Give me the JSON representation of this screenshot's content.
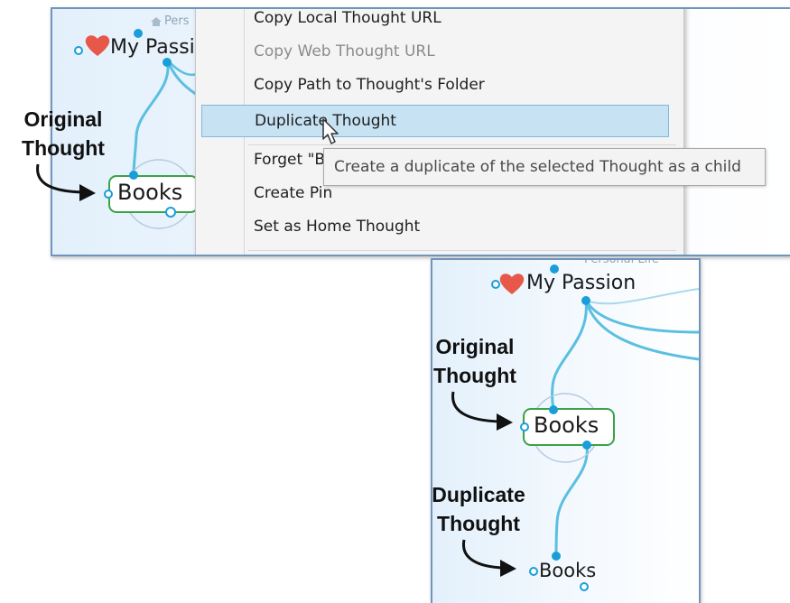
{
  "context_menu": {
    "items": [
      {
        "label": "Copy Local Thought URL",
        "disabled": false
      },
      {
        "label": "Copy Web Thought URL",
        "disabled": true
      },
      {
        "label": "Copy Path to Thought's Folder",
        "disabled": false
      },
      {
        "label": "Duplicate Thought",
        "disabled": false,
        "highlighted": true
      },
      {
        "label": "Forget \"Books\"",
        "disabled": false
      },
      {
        "label": "Create Pin",
        "disabled": false
      },
      {
        "label": "Set as Home Thought",
        "disabled": false
      }
    ],
    "tooltip": "Create a duplicate of the selected Thought as a child"
  },
  "before": {
    "parent_thought": "My Passion",
    "ghost_label": "Pers",
    "selected_thought": "Books",
    "callout": {
      "line1": "Original",
      "line2": "Thought"
    }
  },
  "after": {
    "parent_thought": "My Passion",
    "ghost_label": "Personal Life",
    "original_thought": "Books",
    "duplicate_thought": "Books",
    "callout_original": {
      "line1": "Original",
      "line2": "Thought"
    },
    "callout_duplicate": {
      "line1": "Duplicate",
      "line2": "Thought"
    }
  },
  "colors": {
    "link": "#5bbfe0",
    "node": "#1a9ed9",
    "selected_border": "#3aa349",
    "heart": "#e8584a",
    "menu_highlight": "#c6e2f3"
  },
  "icons": [
    "heart-icon",
    "mouse-pointer-icon",
    "curved-arrow-icon",
    "ghost-thought-icon"
  ]
}
